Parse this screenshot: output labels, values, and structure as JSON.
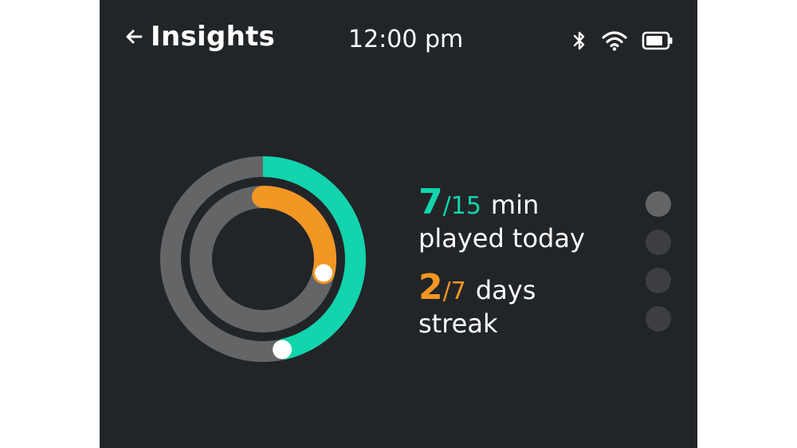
{
  "header": {
    "title": "Insights",
    "time": "12:00 pm",
    "back_icon": "back-arrow-icon",
    "status_icons": [
      "bluetooth-icon",
      "wifi-icon",
      "battery-icon"
    ]
  },
  "colors": {
    "background": "#222528",
    "teal": "#12d4ad",
    "orange": "#f29624",
    "ring_track": "#646567",
    "dot_active": "#646567",
    "dot_inactive": "#3c3e41"
  },
  "progress": {
    "minutes": {
      "value": "7",
      "total": "/15",
      "unit": "min",
      "label": "played today",
      "fraction": 0.4667
    },
    "streak": {
      "value": "2",
      "total": "/7",
      "unit": "days",
      "label": "streak",
      "fraction": 0.2857
    }
  },
  "pager": {
    "count": 4,
    "active_index": 0
  }
}
